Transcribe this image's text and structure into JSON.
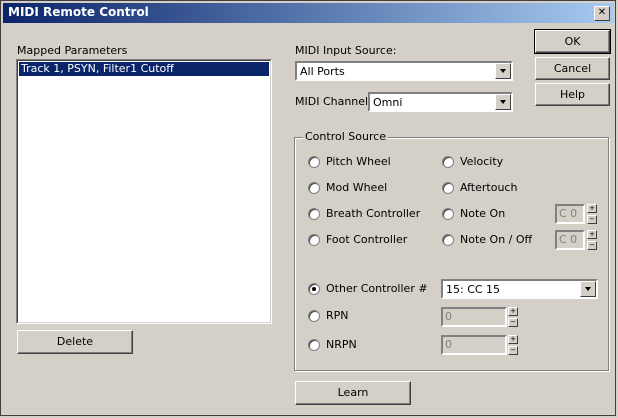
{
  "window": {
    "title": "MIDI Remote Control",
    "close_glyph": "✕"
  },
  "mapped": {
    "label": "Mapped Parameters",
    "items": [
      "Track 1, PSYN, Filter1 Cutoff"
    ]
  },
  "buttons": {
    "ok": "OK",
    "cancel": "Cancel",
    "help": "Help",
    "delete": "Delete",
    "learn": "Learn"
  },
  "midi_input": {
    "label": "MIDI Input Source:",
    "value": "All Ports"
  },
  "midi_channel": {
    "label": "MIDI Channel:",
    "value": "Omni"
  },
  "control_source": {
    "label": "Control Source",
    "options": {
      "pitch_wheel": "Pitch Wheel",
      "mod_wheel": "Mod Wheel",
      "breath": "Breath Controller",
      "foot": "Foot Controller",
      "velocity": "Velocity",
      "aftertouch": "Aftertouch",
      "note_on": "Note On",
      "note_on_off": "Note On / Off",
      "other": "Other Controller #",
      "rpn": "RPN",
      "nrpn": "NRPN"
    },
    "selected": "other",
    "note_on_value": "C 0",
    "note_on_off_value": "C 0",
    "other_controller_value": "15: CC 15",
    "rpn_value": "0",
    "nrpn_value": "0"
  }
}
